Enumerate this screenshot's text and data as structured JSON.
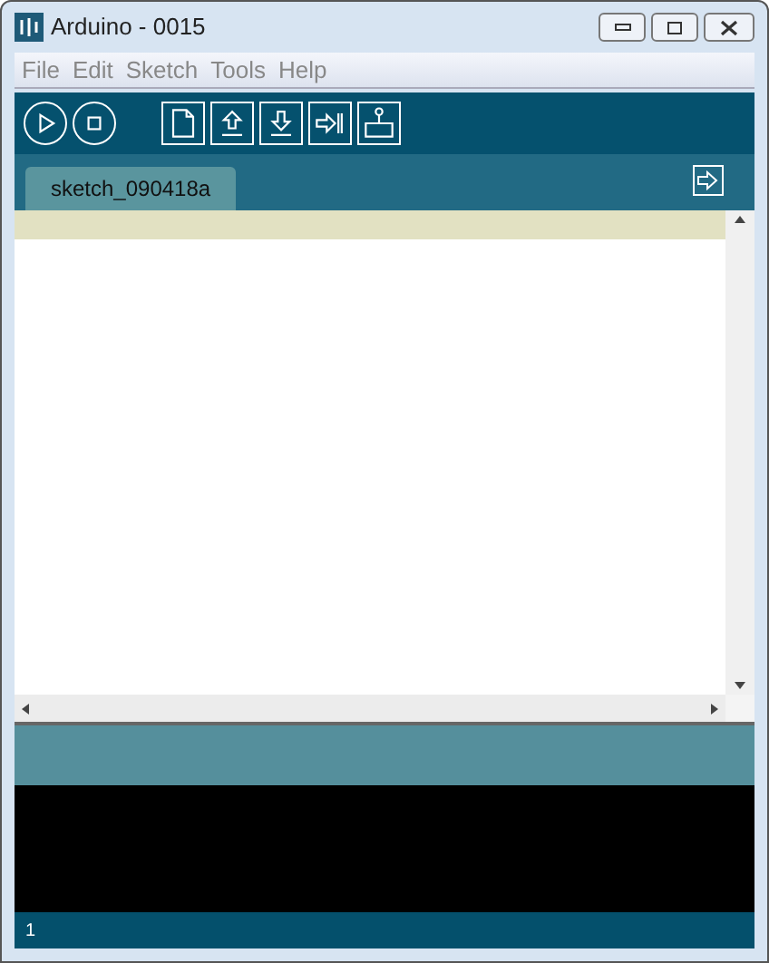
{
  "window": {
    "title": "Arduino - 0015"
  },
  "menu": [
    "File",
    "Edit",
    "Sketch",
    "Tools",
    "Help"
  ],
  "toolbar": [
    {
      "kind": "verify"
    },
    {
      "kind": "stop"
    },
    {
      "kind": "new"
    },
    {
      "kind": "open"
    },
    {
      "kind": "save"
    },
    {
      "kind": "upload"
    },
    {
      "kind": "serial"
    }
  ],
  "tabs": [
    {
      "label": "sketch_090418a",
      "selected": true
    }
  ],
  "status_bar": {
    "line": "1"
  }
}
